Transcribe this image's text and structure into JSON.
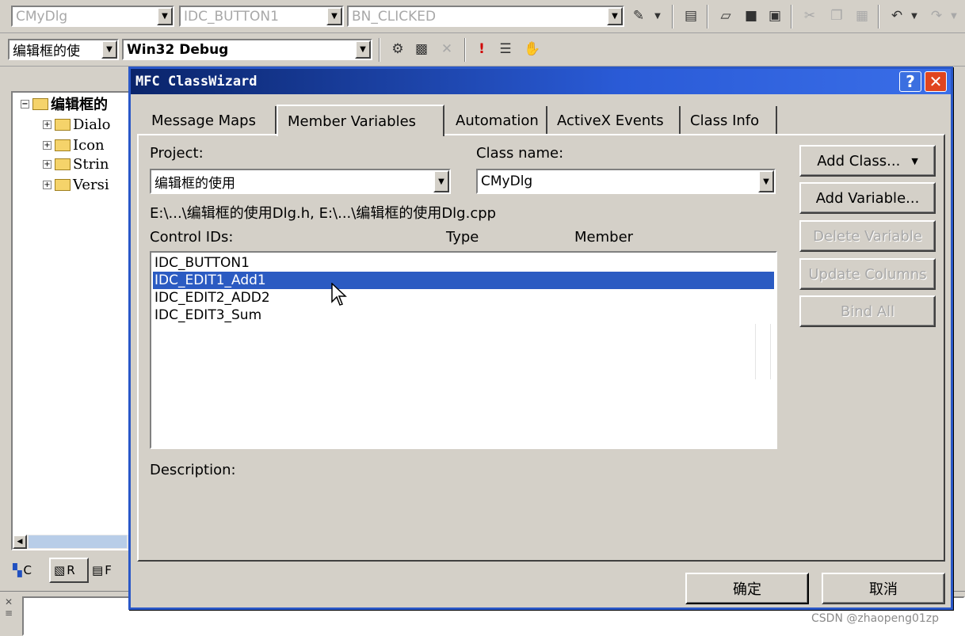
{
  "toolbar1": {
    "class_combo": "CMyDlg",
    "id_combo": "IDC_BUTTON1",
    "msg_combo": "BN_CLICKED"
  },
  "toolbar2": {
    "project_combo": "编辑框的使",
    "config_combo": "Win32 Debug"
  },
  "tree": {
    "root": "编辑框的",
    "items": [
      "Dialo",
      "Icon",
      "Strin",
      "Versi"
    ],
    "tabs": [
      "C",
      "R",
      "F"
    ]
  },
  "dialog": {
    "title": "MFC ClassWizard",
    "help_glyph": "?",
    "close_glyph": "✕",
    "tabs": [
      "Message Maps",
      "Member Variables",
      "Automation",
      "ActiveX Events",
      "Class Info"
    ],
    "project_label": "Project:",
    "project_value": "编辑框的使用",
    "classname_label": "Class name:",
    "classname_value": "CMyDlg",
    "path": "E:\\...\\编辑框的使用Dlg.h, E:\\...\\编辑框的使用Dlg.cpp",
    "columns": [
      "Control IDs:",
      "Type",
      "Member"
    ],
    "controls": [
      "IDC_BUTTON1",
      "IDC_EDIT1_Add1",
      "IDC_EDIT2_ADD2",
      "IDC_EDIT3_Sum"
    ],
    "selected_index": 1,
    "description_label": "Description:",
    "buttons": {
      "add_class": "Add Class...",
      "add_variable": "Add Variable...",
      "delete_variable": "Delete Variable",
      "update_columns": "Update Columns",
      "bind_all": "Bind All"
    },
    "ok": "确定",
    "cancel": "取消"
  },
  "watermark": "CSDN @zhaopeng01zp",
  "colors": {
    "titlebar": "#0a246a",
    "selection": "#2b5bc2",
    "close_button": "#e0451f",
    "help_button": "#3b6fe0"
  }
}
